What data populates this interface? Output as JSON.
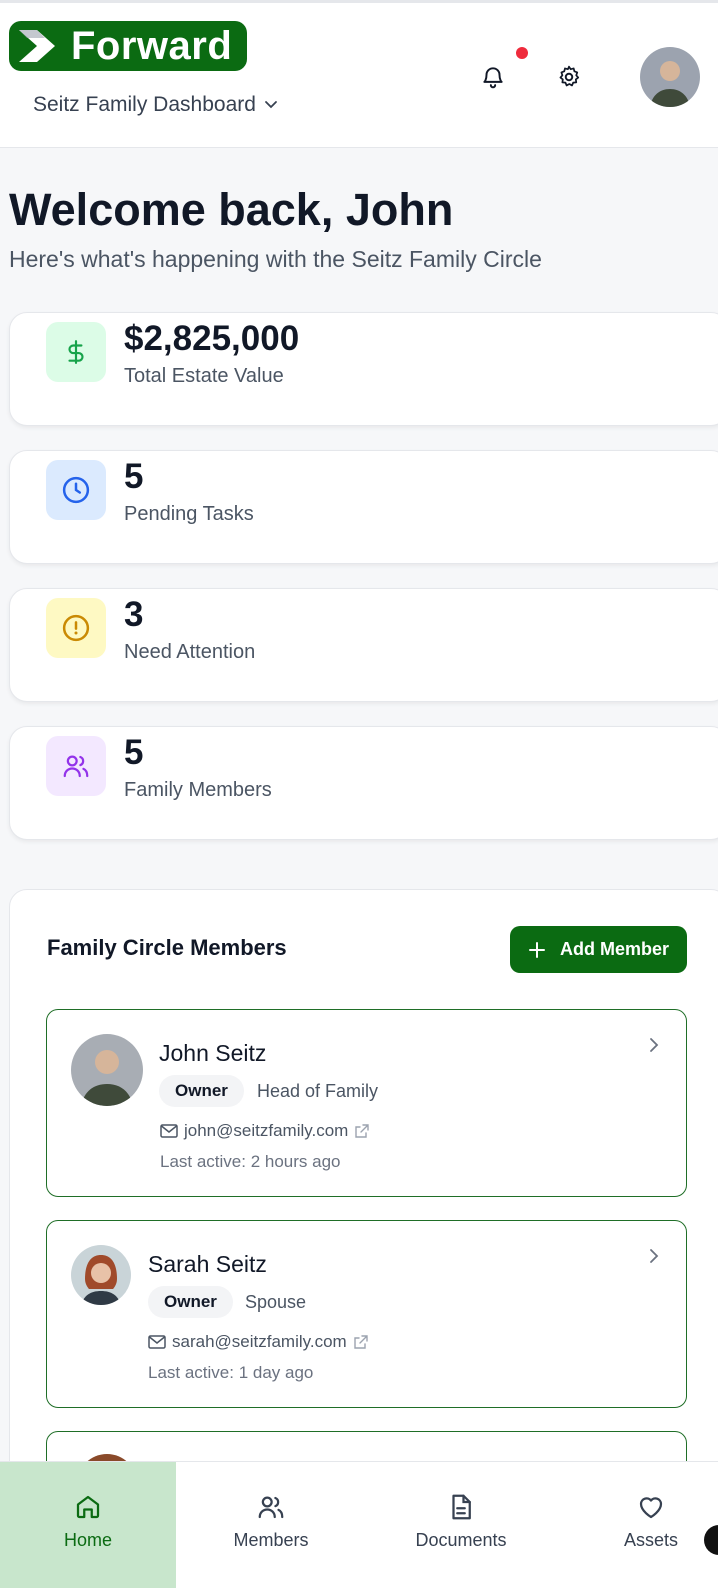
{
  "header": {
    "logo_text": "Forward",
    "dashboard_select": "Seitz Family Dashboard",
    "icons": {
      "notifications": "bell-icon",
      "settings": "gear-icon"
    },
    "notification_dot_color": "#ef2b3c"
  },
  "welcome": {
    "title": "Welcome back, John",
    "subtitle": "Here's what's happening with the Seitz Family Circle"
  },
  "stats": [
    {
      "value": "$2,825,000",
      "label": "Total Estate Value",
      "icon": "dollar-icon",
      "icon_bg": "#dcfce7",
      "icon_color": "#16a34a"
    },
    {
      "value": "5",
      "label": "Pending Tasks",
      "icon": "clock-icon",
      "icon_bg": "#dbeafe",
      "icon_color": "#2563eb"
    },
    {
      "value": "3",
      "label": "Need Attention",
      "icon": "alert-circle-icon",
      "icon_bg": "#fef9c3",
      "icon_color": "#ca8a04"
    },
    {
      "value": "5",
      "label": "Family Members",
      "icon": "users-icon",
      "icon_bg": "#f3e8ff",
      "icon_color": "#9333ea"
    }
  ],
  "members_panel": {
    "title": "Family Circle Members",
    "add_button": "Add Member",
    "members": [
      {
        "name": "John Seitz",
        "role": "Owner",
        "relation": "Head of Family",
        "email": "john@seitzfamily.com",
        "last_active": "Last active: 2 hours ago"
      },
      {
        "name": "Sarah Seitz",
        "role": "Owner",
        "relation": "Spouse",
        "email": "sarah@seitzfamily.com",
        "last_active": "Last active: 1 day ago"
      }
    ]
  },
  "bottom_nav": {
    "items": [
      {
        "label": "Home",
        "icon": "home-icon",
        "active": true
      },
      {
        "label": "Members",
        "icon": "users-icon",
        "active": false
      },
      {
        "label": "Documents",
        "icon": "document-icon",
        "active": false
      },
      {
        "label": "Assets",
        "icon": "heart-icon",
        "active": false
      }
    ]
  },
  "colors": {
    "brand_green": "#0b6b12",
    "active_nav_bg": "#c8e6cc",
    "card_border_green": "#1f6e27"
  }
}
